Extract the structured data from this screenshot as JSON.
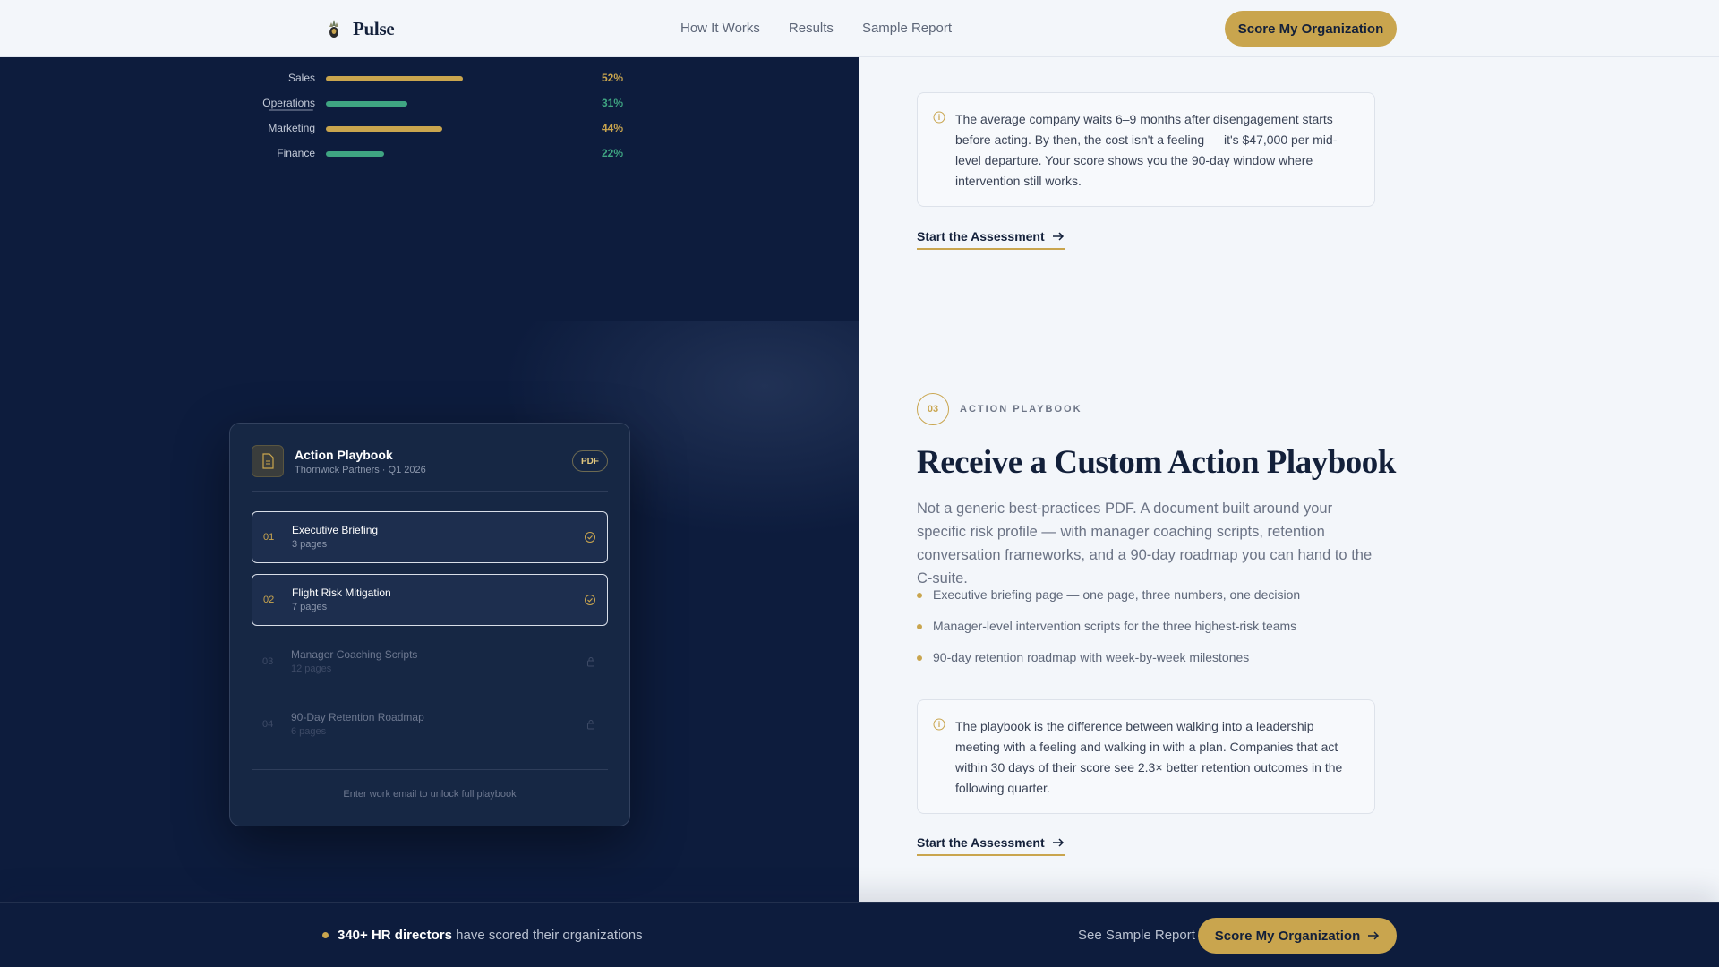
{
  "nav": {
    "brand": "Pulse",
    "links": [
      "How It Works",
      "Results",
      "Sample Report"
    ],
    "cta": "Score My Organization"
  },
  "departments": [
    {
      "name": "Sales",
      "pct": "52%",
      "value": 52,
      "color": "gold"
    },
    {
      "name": "Operations",
      "pct": "31%",
      "value": 31,
      "color": "teal"
    },
    {
      "name": "Marketing",
      "pct": "44%",
      "value": 44,
      "color": "gold"
    },
    {
      "name": "Finance",
      "pct": "22%",
      "value": 22,
      "color": "teal"
    }
  ],
  "section2_tail": {
    "note": "The average company waits 6–9 months after disengagement starts before acting. By then, the cost isn't a feeling — it's $47,000 per mid-level departure. Your score shows you the 90-day window where intervention still works.",
    "cta": "Start the Assessment"
  },
  "playbook_card": {
    "title": "Action Playbook",
    "subtitle": "Thornwick Partners · Q1 2026",
    "badge": "PDF",
    "items": [
      {
        "num": "01",
        "title": "Executive Briefing",
        "pages": "3 pages",
        "state": "unlocked"
      },
      {
        "num": "02",
        "title": "Flight Risk Mitigation",
        "pages": "7 pages",
        "state": "unlocked"
      },
      {
        "num": "03",
        "title": "Manager Coaching Scripts",
        "pages": "12 pages",
        "state": "locked"
      },
      {
        "num": "04",
        "title": "90-Day Retention Roadmap",
        "pages": "6 pages",
        "state": "locked"
      }
    ],
    "footer": "Enter work email to unlock full playbook"
  },
  "section3": {
    "step": "03",
    "label": "ACTION PLAYBOOK",
    "title": "Receive a Custom Action Playbook",
    "description": "Not a generic best-practices PDF. A document built around your specific risk profile — with manager coaching scripts, retention conversation frameworks, and a 90-day roadmap you can hand to the C-suite.",
    "bullets": [
      "Executive briefing page — one page, three numbers, one decision",
      "Manager-level intervention scripts for the three highest-risk teams",
      "90-day retention roadmap with week-by-week milestones"
    ],
    "note": "The playbook is the difference between walking into a leadership meeting with a feeling and walking in with a plan. Companies that act within 30 days of their score see 2.3× better retention outcomes in the following quarter.",
    "cta": "Start the Assessment"
  },
  "bottom_bar": {
    "social_strong": "340+ HR directors",
    "social_rest": "have scored their organizations",
    "sample_link": "See Sample Report",
    "cta": "Score My Organization"
  },
  "colors": {
    "navy": "#0d1c3d",
    "gold": "#c9a54e",
    "teal": "#3fa582",
    "page_bg": "#f3f6fa"
  }
}
